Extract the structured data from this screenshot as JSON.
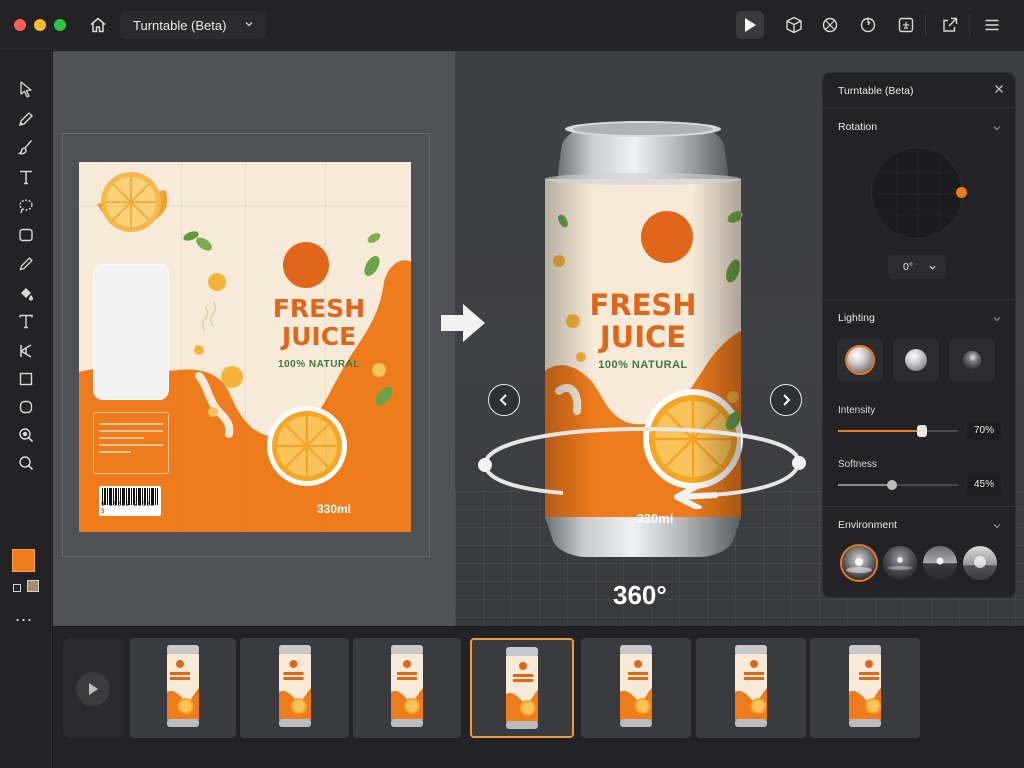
{
  "window": {
    "title": "Turntable (Beta)"
  },
  "topbar": {
    "document_name": "Turntable (Beta)",
    "icons": [
      "home-icon",
      "play-icon",
      "cube-icon",
      "sphere-nodes-icon",
      "compass-icon",
      "frame-icon",
      "share-icon",
      "menu-icon"
    ]
  },
  "toolbar": {
    "tools": [
      "select-arrow-icon",
      "pen-icon",
      "brush-icon",
      "text-icon",
      "lasso-icon",
      "rectangle-icon",
      "pencil-icon",
      "fill-icon",
      "type-icon",
      "puppet-icon",
      "square-icon",
      "circle-icon",
      "zoom-icon",
      "search-icon"
    ],
    "fill_color": "#ee7b1c",
    "secondary_color": "#a88c6c",
    "more": "..."
  },
  "dieline": {
    "title_line1": "FRESH",
    "title_line2": "JUICE",
    "subtitle": "100% NATURAL",
    "volume": "330ml",
    "barcode_number": "9 55332 22338 5"
  },
  "preview": {
    "title_line1": "FRESH",
    "title_line2": "JUICE",
    "subtitle": "100% NATURAL",
    "volume": "330ml",
    "rotation_badge": "360°"
  },
  "panel": {
    "title": "Turntable (Beta)",
    "rotation": {
      "section": "Rotation",
      "angle": "0°"
    },
    "lighting": {
      "section": "Lighting",
      "presets": [
        "soft-light",
        "studio-light",
        "dramatic-light"
      ],
      "selected_index": 0,
      "intensity_label": "Intensity",
      "intensity_value": "70%",
      "intensity": 0.7,
      "softness_label": "Softness",
      "softness_value": "45%",
      "softness": 0.45
    },
    "environment": {
      "section": "Environment",
      "presets": [
        "studio-env",
        "spotlight-env",
        "horizon-env",
        "daylight-env"
      ],
      "selected_index": 0
    }
  },
  "timeline": {
    "frame_count": 7,
    "selected_index": 3
  },
  "colors": {
    "accent": "#ee7b1c",
    "brand_orange": "#e0661a",
    "brand_green": "#3e7a3a",
    "cream": "#f7ead8"
  }
}
